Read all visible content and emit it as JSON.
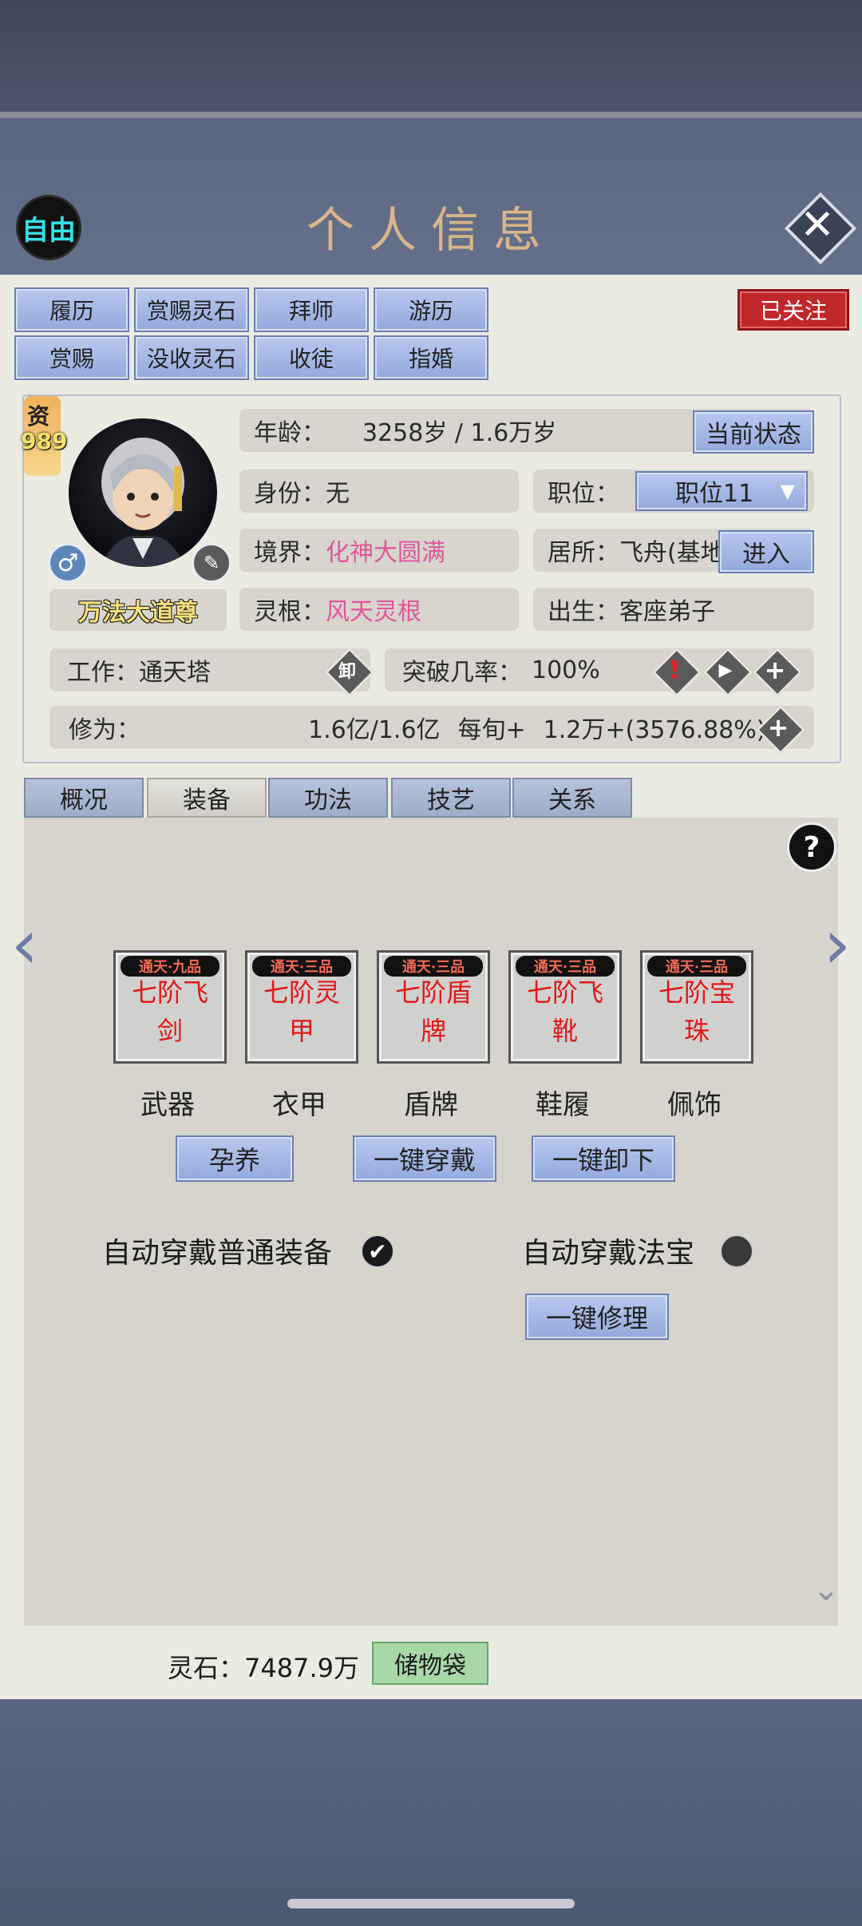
{
  "header": {
    "free_badge": "自由",
    "title": "个人信息",
    "close_icon": "close-icon"
  },
  "actions": {
    "row1": [
      "履历",
      "赏赐灵石",
      "拜师",
      "游历"
    ],
    "row2": [
      "赏赐",
      "没收灵石",
      "收徒",
      "指婚"
    ],
    "followed": "已关注"
  },
  "profile": {
    "aptitude_label": "资",
    "aptitude_value": "989",
    "title": "万法大道尊",
    "age_label": "年龄：",
    "age_value": "3258岁 / 1.6万岁",
    "current_state": "当前状态",
    "identity_label": "身份：",
    "identity_value": "无",
    "position_label": "职位：",
    "position_value": "职位11",
    "realm_label": "境界：",
    "realm_value": "化神大圆满",
    "residence_label": "居所：",
    "residence_value": "飞舟(基地",
    "enter": "进入",
    "root_label": "灵根：",
    "root_value": "风天灵根",
    "birth_label": "出生：",
    "birth_value": "客座弟子",
    "work_label": "工作：",
    "work_value": "通天塔",
    "unequip_icon_text": "卸",
    "breakthrough_label": "突破几率：",
    "breakthrough_value": "100%",
    "cultivation_label": "修为：",
    "cultivation_value": "1.6亿/1.6亿",
    "per_period_label": "每旬+",
    "per_period_value": "1.2万+(3576.88%)"
  },
  "tabs": [
    "概况",
    "装备",
    "功法",
    "技艺",
    "关系"
  ],
  "active_tab": "装备",
  "equipment": [
    {
      "tier": "通天·九品",
      "name": "七阶飞剑",
      "label": "武器"
    },
    {
      "tier": "通天·三品",
      "name": "七阶灵甲",
      "label": "衣甲"
    },
    {
      "tier": "通天·三品",
      "name": "七阶盾牌",
      "label": "盾牌"
    },
    {
      "tier": "通天·三品",
      "name": "七阶飞靴",
      "label": "鞋履"
    },
    {
      "tier": "通天·三品",
      "name": "七阶宝珠",
      "label": "佩饰"
    }
  ],
  "equip_buttons": {
    "nurture": "孕养",
    "equip_all": "一键穿戴",
    "unequip_all": "一键卸下",
    "repair_all": "一键修理"
  },
  "options": {
    "auto_normal": "自动穿戴普通装备",
    "auto_normal_checked": true,
    "auto_treasure": "自动穿戴法宝",
    "auto_treasure_checked": false
  },
  "help": "?",
  "footer": {
    "spirit_stone": "灵石：7487.9万",
    "bag": "储物袋"
  },
  "colors": {
    "accent_blue": "#94a9dc",
    "followed_red": "#c0272b",
    "realm_pink": "#e0569a",
    "equip_red": "#e01818",
    "bag_green": "#a8d7a8"
  }
}
